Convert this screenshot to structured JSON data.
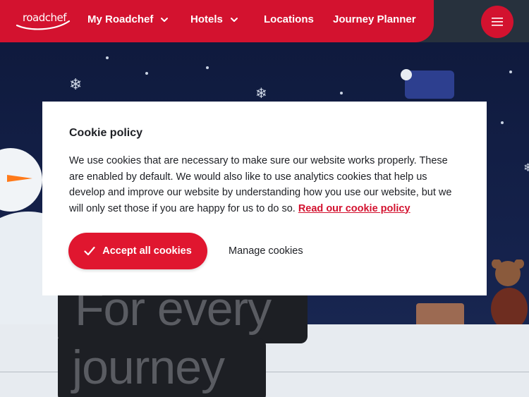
{
  "header": {
    "logo_text": "roadchef",
    "nav": [
      {
        "label": "My Roadchef",
        "has_dropdown": true
      },
      {
        "label": "Hotels",
        "has_dropdown": true
      },
      {
        "label": "Locations",
        "has_dropdown": false
      },
      {
        "label": "Journey Planner",
        "has_dropdown": false
      }
    ],
    "menu_icon": "hamburger-icon"
  },
  "hero": {
    "tagline_line1": "For every",
    "tagline_line2": "journey"
  },
  "cookie_modal": {
    "title": "Cookie policy",
    "body": "We use cookies that are necessary to make sure our website works properly. These are enabled by default. We would also like to use analytics cookies that help us develop and improve our website by understanding how you use our website, but we will only set those if you are happy for us to do so.",
    "link_text": "Read our cookie policy",
    "accept_label": "Accept all cookies",
    "manage_label": "Manage cookies"
  },
  "colors": {
    "brand_red": "#d3122f",
    "header_dark": "#27313d",
    "text_dark": "#1d1f24"
  }
}
